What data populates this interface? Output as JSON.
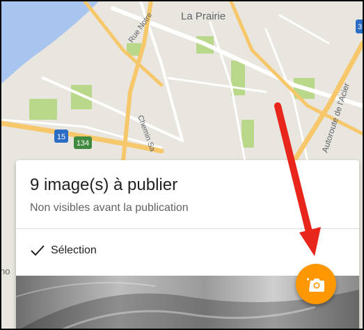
{
  "map": {
    "labels": {
      "city": "La Prairie",
      "street_notre": "Rue Notre",
      "street_chemin": "Chemin Sa",
      "autoroute": "Autoroute de l'Acier",
      "shield_15": "15",
      "shield_134": "134",
      "shield_3": "3",
      "edge_letters": "no"
    },
    "colors": {
      "water": "#a8c5f0",
      "land": "#e9e6df",
      "park": "#b9d88a",
      "highway": "#f7c86b",
      "road": "#ffffff",
      "shield_blue": "#2b6cc4",
      "shield_green": "#3f8a3f"
    }
  },
  "publish_card": {
    "title": "9 image(s) à publier",
    "subtitle": "Non visibles avant la publication",
    "selection_label": "Sélection"
  },
  "fab": {
    "icon": "add-photo-camera-icon",
    "color": "#ff9800"
  },
  "annotation": {
    "icon": "red-pointer-arrow",
    "color": "#e8261b"
  }
}
